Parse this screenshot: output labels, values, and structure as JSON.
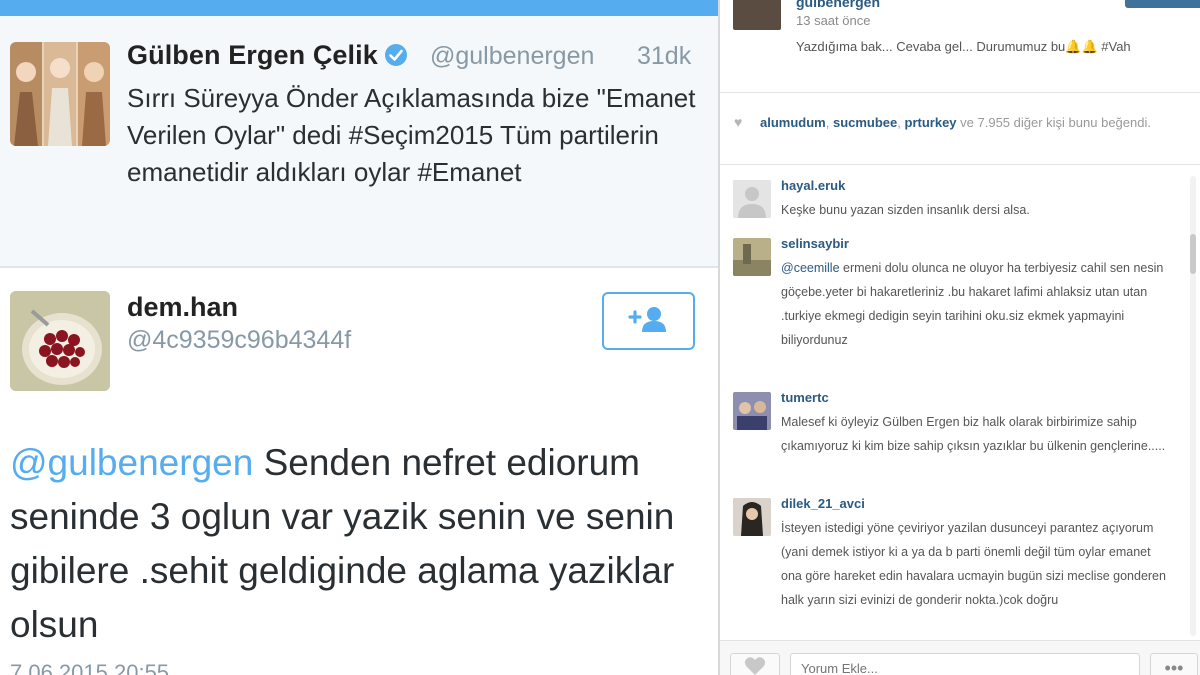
{
  "colors": {
    "twitter_blue": "#55acee",
    "instagram_link": "#2b5a83"
  },
  "tweet_main": {
    "name": "Gülben Ergen Çelik",
    "handle": "@gulbenergen",
    "time": "31dk",
    "text": "Sırrı Süreyya Önder Açıklamasında bize \"Emanet Verilen Oylar\" dedi #Seçim2015 Tüm partilerin emanetidir aldıkları oylar #Emanet",
    "verified_icon": "verified-badge-icon"
  },
  "tweet_reply": {
    "name": "dem.han",
    "handle": "@4c9359c96b4344f",
    "mention": "@gulbenergen",
    "text": " Senden nefret ediorum seninde 3 oglun var yazik senin ve senin gibilere .sehit geldiginde aglama yaziklar olsun",
    "date": "7.06.2015 20:55",
    "follow_icon": "add-user-icon"
  },
  "instagram": {
    "top_user": "gulbenergen",
    "time": "13 saat önce",
    "caption": "Yazdığıma bak... Cevaba gel... Durumumuz bu🔔🔔 #Vah",
    "likes": {
      "heart_icon": "heart-icon",
      "user1": "alumudum",
      "user2": "sucmubee",
      "user3": "prturkey",
      "rest": " ve 7.955 diğer kişi bunu beğendi."
    },
    "comments": [
      {
        "user": "hayal.eruk",
        "mention": "",
        "text": "Keşke bunu yazan sizden insanlık dersi alsa."
      },
      {
        "user": "selinsaybir",
        "mention": "@ceemille",
        "text": " ermeni dolu olunca ne oluyor ha terbiyesiz cahil sen nesin göçebe.yeter bi hakaretleriniz .bu hakaret lafimi ahlaksiz utan utan .turkiye ekmegi dedigin seyin tarihini oku.siz ekmek yapmayini biliyordunuz"
      },
      {
        "user": "tumertc",
        "mention": "",
        "text": "Malesef ki öyleyiz Gülben Ergen biz halk olarak birbirimize sahip çıkamıyoruz ki kim bize sahip çıksın yazıklar bu ülkenin gençlerine....."
      },
      {
        "user": "dilek_21_avci",
        "mention": "",
        "text": "İsteyen istedigi yöne çeviriyor yazilan dusunceyi parantez açıyorum (yani demek istiyor ki a ya da b parti önemli değil tüm oylar emanet ona göre hareket edin havalara ucmayin bugün sizi meclise gonderen halk yarın sizi evinizi de gonderir nokta.)cok doğru"
      }
    ],
    "comment_placeholder": "Yorum Ekle...",
    "more_label": "•••"
  }
}
